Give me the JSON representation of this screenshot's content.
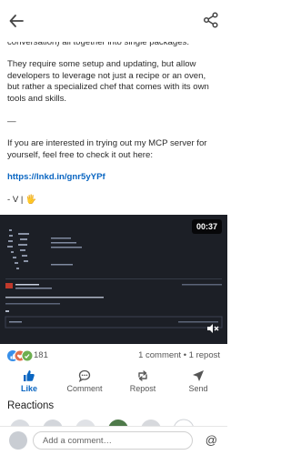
{
  "post": {
    "partial_top": "run at specific events like starting or ending a conversation) all together into single packages.",
    "para2": "They require some setup and updating, but allow developers to leverage not just a recipe or an oven, but rather a specialized chef that comes with its own tools and skills.",
    "dash": "—",
    "para3": "If you are interested in trying out my MCP server for yourself, feel free to check it out here:",
    "link": "https://lnkd.in/gnr5yYPf",
    "sign": "- V | 🖐"
  },
  "video": {
    "duration": "00:37"
  },
  "reactions": {
    "count": "181",
    "stats": "1 comment • 1 repost"
  },
  "actions": {
    "like": "Like",
    "comment": "Comment",
    "repost": "Repost",
    "send": "Send"
  },
  "reactions_header": "Reactions",
  "comment_box": {
    "placeholder": "Add a comment…",
    "mention_symbol": "@"
  }
}
